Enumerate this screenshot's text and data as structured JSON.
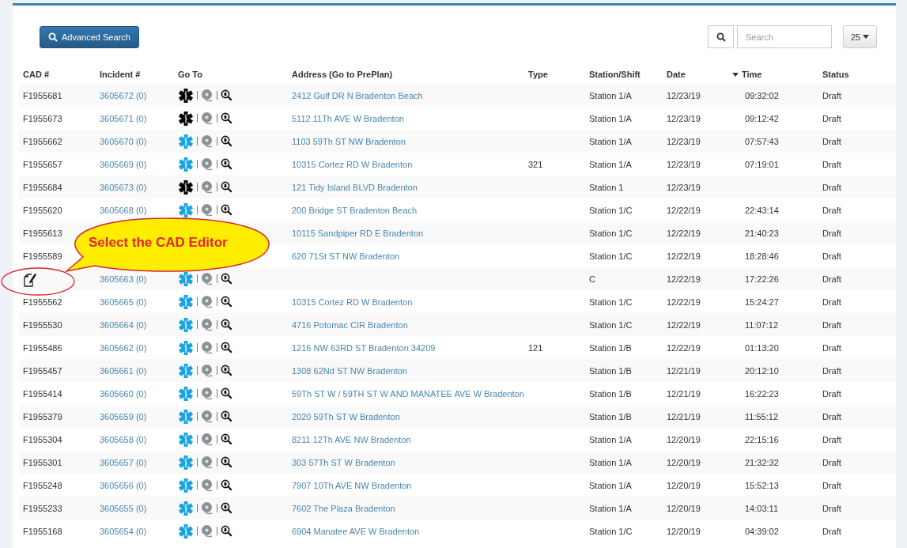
{
  "toolbar": {
    "advanced_search": "Advanced Search",
    "search": {
      "placeholder": "Search"
    },
    "page_size": "25"
  },
  "table": {
    "columns": [
      {
        "label": "CAD #",
        "sorted": false
      },
      {
        "label": "Incident #",
        "sorted": false
      },
      {
        "label": "Go To",
        "sorted": false
      },
      {
        "label": "Address (Go to PrePlan)",
        "sorted": false
      },
      {
        "label": "Type",
        "sorted": false
      },
      {
        "label": "Station/Shift",
        "sorted": false
      },
      {
        "label": "Date",
        "sorted": false
      },
      {
        "label": "Time",
        "sorted": true
      },
      {
        "label": "Status",
        "sorted": false
      }
    ],
    "rows": [
      {
        "kind": "plain",
        "cad": "F1955681",
        "incident": "3605672 (0)",
        "color": "#000000",
        "address": "2412 Gulf DR N Bradenton Beach",
        "station": "Station 1/A",
        "date": "12/23/19",
        "time": "09:32:02",
        "status": "Draft"
      },
      {
        "kind": "plain",
        "cad": "F1955673",
        "incident": "3605671 (0)",
        "color": "#000000",
        "address": "5112 11Th AVE W Bradenton",
        "station": "Station 1/A",
        "date": "12/23/19",
        "time": "09:12:42",
        "status": "Draft"
      },
      {
        "kind": "plain",
        "cad": "F1955662",
        "incident": "3605670 (0)",
        "color": "#1aa3e0",
        "address": "1103 59Th ST NW Bradenton",
        "station": "Station 1/A",
        "date": "12/23/19",
        "time": "07:57:43",
        "status": "Draft"
      },
      {
        "kind": "plain",
        "cad": "F1955657",
        "incident": "3605669 (0)",
        "color": "#1aa3e0",
        "address": "10315 Cortez RD W Bradenton",
        "type": "321",
        "station": "Station 1/A",
        "date": "12/23/19",
        "time": "07:19:01",
        "status": "Draft"
      },
      {
        "kind": "plain",
        "cad": "F1955684",
        "incident": "3605673 (0)",
        "color": "#000000",
        "address": "121 Tidy Island BLVD Bradenton",
        "station": "Station 1",
        "date": "12/23/19",
        "status": "Draft"
      },
      {
        "kind": "plain",
        "cad": "F1955620",
        "incident": "3605668 (0)",
        "color": "#1aa3e0",
        "address": "200 Bridge ST Bradenton Beach",
        "station": "Station 1/C",
        "date": "12/22/19",
        "time": "22:43:14",
        "status": "Draft"
      },
      {
        "kind": "plain",
        "cad": "F1955613",
        "address": "10115 Sandpiper RD E Bradenton",
        "station": "Station 1/C",
        "date": "12/22/19",
        "time": "21:40:23",
        "status": "Draft"
      },
      {
        "kind": "plain",
        "cad": "F1955589",
        "address": "620 71St ST NW Bradenton",
        "station": "Station 1/C",
        "date": "12/22/19",
        "time": "18:28:46",
        "status": "Draft"
      },
      {
        "kind": "editor",
        "incident": "3605663 (0)",
        "color": "#1aa3e0",
        "station": "C",
        "date": "12/22/19",
        "time": "17:22:26",
        "status": "Draft"
      },
      {
        "kind": "plain",
        "cad": "F1955562",
        "incident": "3605665 (0)",
        "color": "#1aa3e0",
        "address": "10315 Cortez RD W Bradenton",
        "station": "Station 1/C",
        "date": "12/22/19",
        "time": "15:24:27",
        "status": "Draft"
      },
      {
        "kind": "plain",
        "cad": "F1955530",
        "incident": "3605664 (0)",
        "color": "#1aa3e0",
        "address": "4716 Potomac CIR Bradenton",
        "station": "Station 1/C",
        "date": "12/22/19",
        "time": "11:07:12",
        "status": "Draft"
      },
      {
        "kind": "plain",
        "cad": "F1955486",
        "incident": "3605662 (0)",
        "color": "#1aa3e0",
        "address": "1216 NW 63RD ST Bradenton 34209",
        "type": "121",
        "station": "Station 1/B",
        "date": "12/22/19",
        "time": "01:13:20",
        "status": "Draft"
      },
      {
        "kind": "plain",
        "cad": "F1955457",
        "incident": "3605661 (0)",
        "color": "#1aa3e0",
        "address": "1308 62Nd ST NW Bradenton",
        "station": "Station 1/B",
        "date": "12/21/19",
        "time": "20:12:10",
        "status": "Draft"
      },
      {
        "kind": "plain",
        "cad": "F1955414",
        "incident": "3605660 (0)",
        "color": "#1aa3e0",
        "address": "59Th ST W / 59TH ST W AND MANATEE AVE W Bradenton",
        "station": "Station 1/B",
        "date": "12/21/19",
        "time": "16:22:23",
        "status": "Draft"
      },
      {
        "kind": "plain",
        "cad": "F1955379",
        "incident": "3605659 (0)",
        "color": "#1aa3e0",
        "address": "2020 59Th ST W Bradenton",
        "station": "Station 1/B",
        "date": "12/21/19",
        "time": "11:55:12",
        "status": "Draft"
      },
      {
        "kind": "plain",
        "cad": "F1955304",
        "incident": "3605658 (0)",
        "color": "#1aa3e0",
        "address": "8211 12Th AVE NW Bradenton",
        "station": "Station 1/A",
        "date": "12/20/19",
        "time": "22:15:16",
        "status": "Draft"
      },
      {
        "kind": "plain",
        "cad": "F1955301",
        "incident": "3605657 (0)",
        "color": "#1aa3e0",
        "address": "303 57Th ST W Bradenton",
        "station": "Station 1/A",
        "date": "12/20/19",
        "time": "21:32:32",
        "status": "Draft"
      },
      {
        "kind": "plain",
        "cad": "F1955248",
        "incident": "3605656 (0)",
        "color": "#1aa3e0",
        "address": "7907 10Th AVE NW Bradenton",
        "station": "Station 1/A",
        "date": "12/20/19",
        "time": "15:52:13",
        "status": "Draft"
      },
      {
        "kind": "plain",
        "cad": "F1955233",
        "incident": "3605655 (0)",
        "color": "#1aa3e0",
        "address": "7602 The Plaza Bradenton",
        "station": "Station 1/A",
        "date": "12/20/19",
        "time": "14:03:11",
        "status": "Draft"
      },
      {
        "kind": "plain",
        "cad": "F1955168",
        "incident": "3605654 (0)",
        "color": "#1aa3e0",
        "address": "6904 Manatee AVE W Bradenton",
        "station": "Station 1/C",
        "date": "12/20/19",
        "time": "04:39:02",
        "status": "Draft"
      }
    ]
  },
  "callout": {
    "text": "Select the CAD Editor"
  }
}
